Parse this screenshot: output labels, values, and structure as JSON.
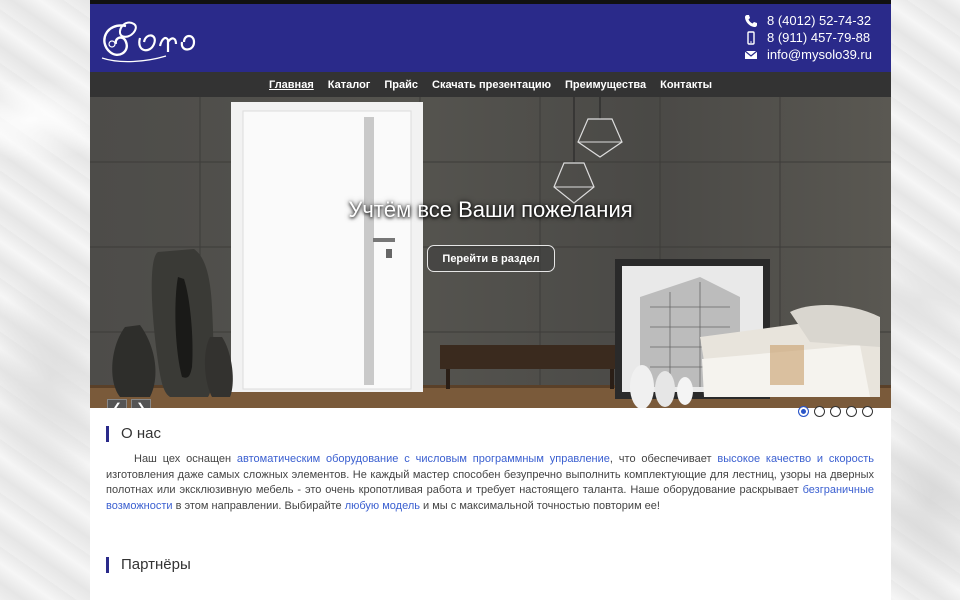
{
  "header": {
    "phone1": "8 (4012) 52-74-32",
    "phone2": "8 (911) 457-79-88",
    "email": "info@mysolo39.ru",
    "bg_color": "#2a2a8a"
  },
  "nav": {
    "items": [
      "Главная",
      "Каталог",
      "Прайс",
      "Скачать презентацию",
      "Преимущества",
      "Контакты"
    ],
    "active": "Главная"
  },
  "slider": {
    "title": "Учтём все Ваши пожелания",
    "button": "Перейти в раздел",
    "prev_icon": "chevron-left-icon",
    "next_icon": "chevron-right-icon",
    "slide_count": 5,
    "active_slide": 1
  },
  "about": {
    "heading": "О нас",
    "p_1": "Наш цех оснащен ",
    "link_1": "автоматическим оборудование с числовым программным управление",
    "p_2": ", что обеспечивает ",
    "link_2": "высокое качество и скорость",
    "p_3": " изготовления даже самых сложных элементов. Не каждый мастер способен безупречно выполнить комплектующие для лестниц, узоры на дверных полотнах или эксклюзивную мебель - это очень кропотливая работа и требует настоящего таланта. Наше оборудование раскрывает ",
    "link_3": "безграничные возможности",
    "p_4": " в этом направлении. Выбирайте ",
    "link_4": "любую модель",
    "p_5": " и мы с максимальной точностью повторим ее!",
    "link_color": "#3a5fd0"
  },
  "partners": {
    "heading": "Партнёры"
  }
}
